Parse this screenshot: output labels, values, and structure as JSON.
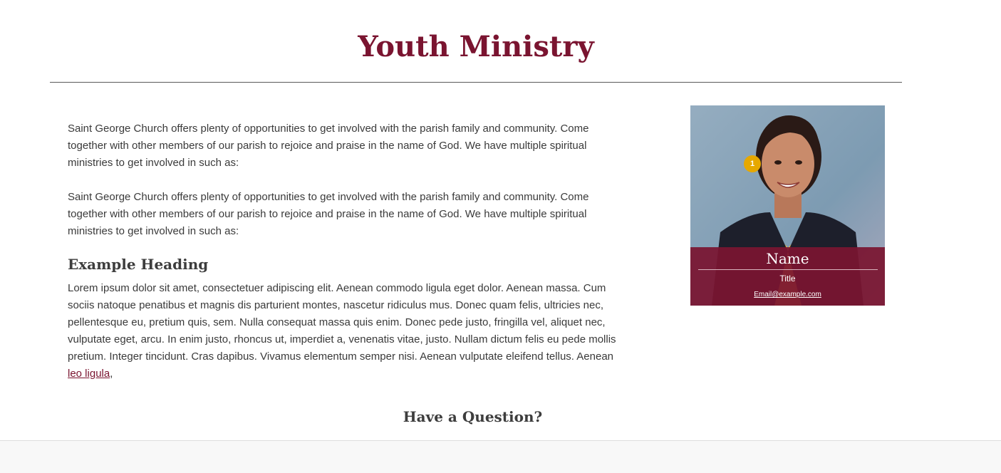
{
  "page": {
    "title": "Youth Ministry",
    "accent_color": "#7a1430"
  },
  "main": {
    "paragraphs": [
      "Saint George Church offers plenty of opportunities to get involved with the parish family and community. Come together with other members of our parish to rejoice and praise in the name of God. We have multiple spiritual ministries to get involved in such as:",
      "Saint George Church offers plenty of opportunities to get involved with the parish family and community. Come together with other members of our parish to rejoice and praise in the name of God. We have multiple spiritual ministries to get involved in such as:"
    ],
    "heading": "Example Heading",
    "body": "Lorem ipsum dolor sit amet, consectetuer adipiscing elit. Aenean commodo ligula eget dolor. Aenean massa. Cum sociis natoque penatibus et magnis dis parturient montes, nascetur ridiculus mus. Donec quam felis, ultricies nec, pellentesque eu, pretium quis, sem. Nulla consequat massa quis enim. Donec pede justo, fringilla vel, aliquet nec, vulputate eget, arcu. In enim justo, rhoncus ut, imperdiet a, venenatis vitae, justo. Nullam dictum felis eu pede mollis pretium. Integer tincidunt. Cras dapibus. Vivamus elementum semper nisi. Aenean vulputate eleifend tellus. Aenean",
    "link_text": "leo ligula",
    "after_link": ","
  },
  "staff_card": {
    "badge": "1",
    "name": "Name",
    "title": "Title",
    "email": "Email@example.com"
  },
  "question": {
    "heading": "Have a Question?"
  }
}
